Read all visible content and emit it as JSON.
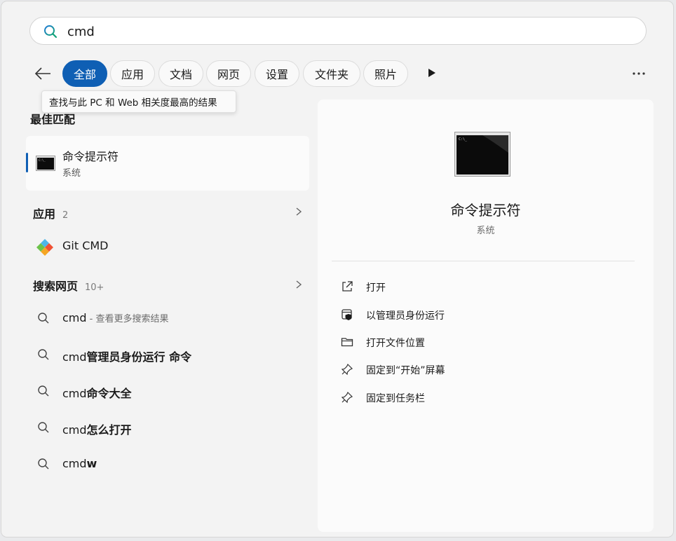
{
  "search": {
    "query": "cmd"
  },
  "filters": {
    "chips": [
      "全部",
      "应用",
      "文档",
      "网页",
      "设置",
      "文件夹",
      "照片"
    ],
    "active_index": 0
  },
  "tooltip": "查找与此 PC 和 Web 相关度最高的结果",
  "best_match": {
    "heading": "最佳匹配",
    "title": "命令提示符",
    "subtitle": "系统"
  },
  "apps": {
    "heading": "应用",
    "count": "2",
    "items": [
      {
        "label": "Git CMD"
      }
    ]
  },
  "web": {
    "heading": "搜索网页",
    "count": "10+",
    "items": [
      {
        "prefix": "cmd",
        "suffix": "",
        "hint": " - 查看更多搜索结果"
      },
      {
        "prefix": "cmd",
        "suffix": "管理员身份运行 命令",
        "hint": ""
      },
      {
        "prefix": "cmd",
        "suffix": "命令大全",
        "hint": ""
      },
      {
        "prefix": "cmd",
        "suffix": "怎么打开",
        "hint": ""
      },
      {
        "prefix": "cmd",
        "suffix": "w",
        "hint": ""
      }
    ]
  },
  "detail": {
    "title": "命令提示符",
    "subtitle": "系统",
    "actions": [
      {
        "label": "打开",
        "icon": "open-external-icon"
      },
      {
        "label": "以管理员身份运行",
        "icon": "shield-admin-icon"
      },
      {
        "label": "打开文件位置",
        "icon": "folder-icon"
      },
      {
        "label": "固定到“开始”屏幕",
        "icon": "pin-icon"
      },
      {
        "label": "固定到任务栏",
        "icon": "pin-icon"
      }
    ]
  },
  "colors": {
    "accent": "#0f5fb4"
  }
}
